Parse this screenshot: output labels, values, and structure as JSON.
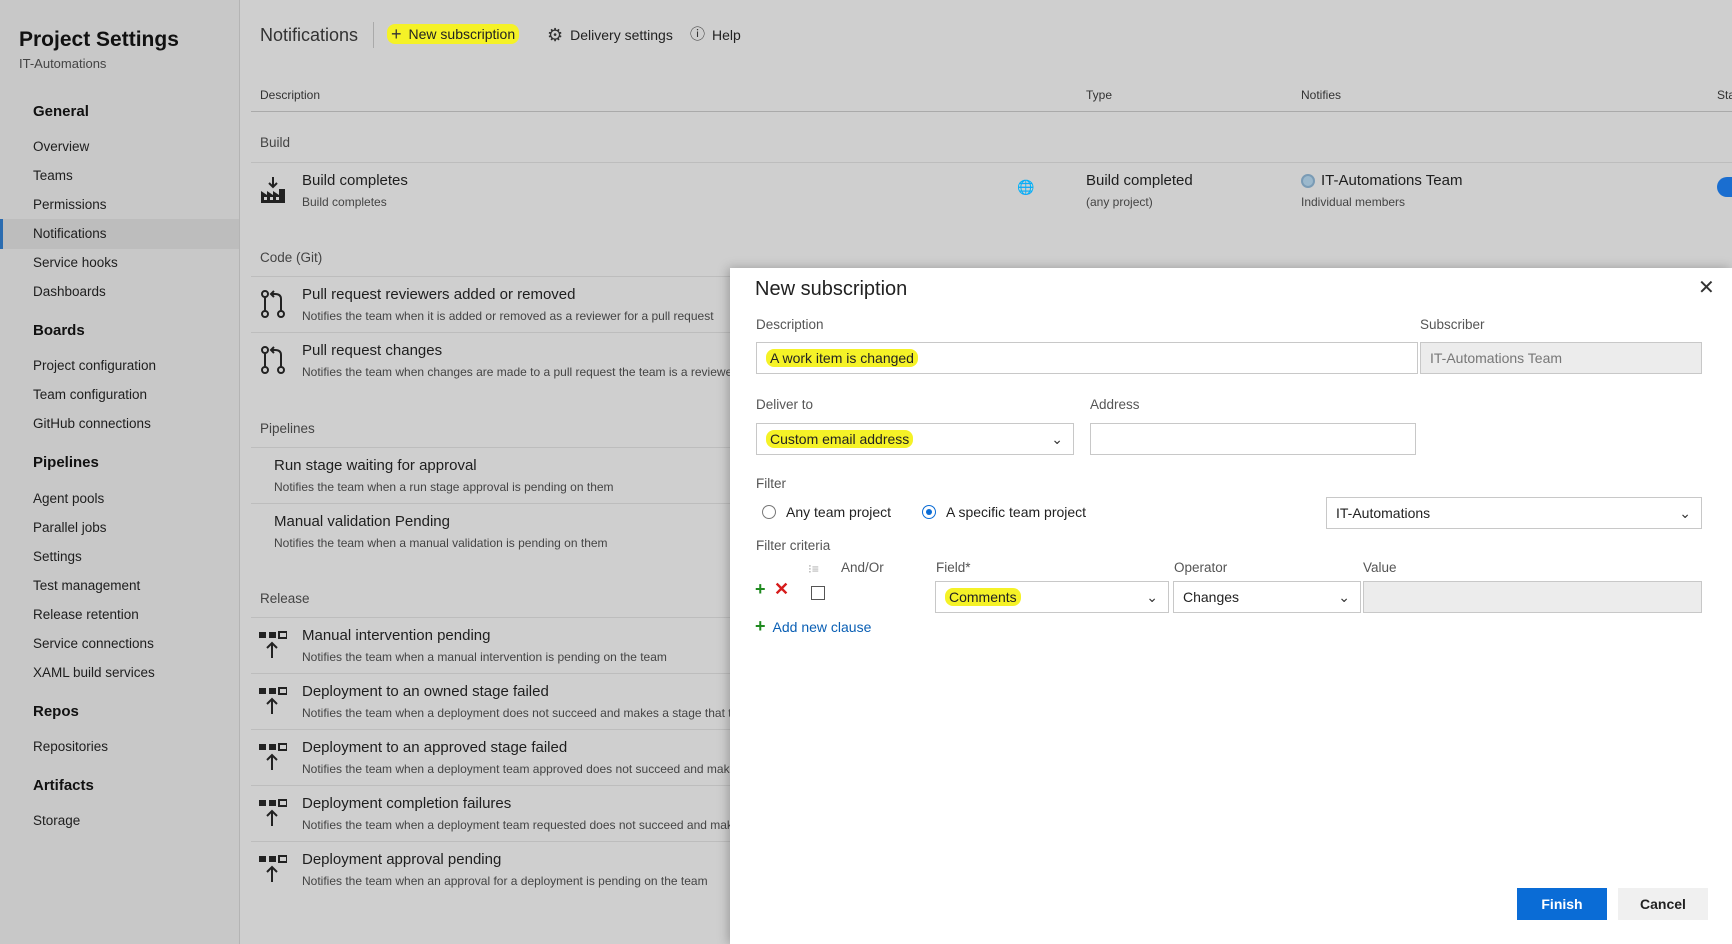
{
  "sidebar": {
    "title": "Project Settings",
    "subtitle": "IT-Automations",
    "sections": [
      {
        "label": "General",
        "items": [
          "Overview",
          "Teams",
          "Permissions",
          "Notifications",
          "Service hooks",
          "Dashboards"
        ]
      },
      {
        "label": "Boards",
        "items": [
          "Project configuration",
          "Team configuration",
          "GitHub connections"
        ]
      },
      {
        "label": "Pipelines",
        "items": [
          "Agent pools",
          "Parallel jobs",
          "Settings",
          "Test management",
          "Release retention",
          "Service connections",
          "XAML build services"
        ]
      },
      {
        "label": "Repos",
        "items": [
          "Repositories"
        ]
      },
      {
        "label": "Artifacts",
        "items": [
          "Storage"
        ]
      }
    ],
    "selected_item": "Notifications"
  },
  "toolbar": {
    "title": "Notifications",
    "new_subscription": "New subscription",
    "delivery_settings": "Delivery settings",
    "help": "Help"
  },
  "table": {
    "headers": {
      "description": "Description",
      "type": "Type",
      "notifies": "Notifies",
      "state": "State"
    },
    "groups": {
      "build": "Build",
      "code": "Code (Git)",
      "pipelines": "Pipelines",
      "release": "Release"
    },
    "build_row": {
      "title": "Build completes",
      "sub": "Build completes",
      "type": "Build completed",
      "type_sub": "(any project)",
      "notifies": "IT-Automations Team",
      "notifies_sub": "Individual members"
    },
    "code_rows": [
      {
        "title": "Pull request reviewers added or removed",
        "sub": "Notifies the team when it is added or removed as a reviewer for a pull request"
      },
      {
        "title": "Pull request changes",
        "sub": "Notifies the team when changes are made to a pull request the team is a reviewer"
      }
    ],
    "pipeline_rows": [
      {
        "title": "Run stage waiting for approval",
        "sub": "Notifies the team when a run stage approval is pending on them"
      },
      {
        "title": "Manual validation Pending",
        "sub": "Notifies the team when a manual validation is pending on them"
      }
    ],
    "release_rows": [
      {
        "title": "Manual intervention pending",
        "sub": "Notifies the team when a manual intervention is pending on the team"
      },
      {
        "title": "Deployment to an owned stage failed",
        "sub": "Notifies the team when a deployment does not succeed and makes a stage that th"
      },
      {
        "title": "Deployment to an approved stage failed",
        "sub": "Notifies the team when a deployment team approved does not succeed and make"
      },
      {
        "title": "Deployment completion failures",
        "sub": "Notifies the team when a deployment team requested does not succeed and mak"
      },
      {
        "title": "Deployment approval pending",
        "sub": "Notifies the team when an approval for a deployment is pending on the team"
      }
    ]
  },
  "dialog": {
    "title": "New subscription",
    "description_label": "Description",
    "description_value": "A work item is changed",
    "subscriber_label": "Subscriber",
    "subscriber_value": "IT-Automations Team",
    "deliver_to_label": "Deliver to",
    "deliver_to_value": "Custom email address",
    "address_label": "Address",
    "address_value": "",
    "filter_label": "Filter",
    "filter_any": "Any team project",
    "filter_specific": "A specific team project",
    "filter_project_value": "IT-Automations",
    "criteria_label": "Filter criteria",
    "andor_label": "And/Or",
    "field_label": "Field*",
    "field_value": "Comments",
    "operator_label": "Operator",
    "operator_value": "Changes",
    "value_label": "Value",
    "add_clause": "Add new clause",
    "finish": "Finish",
    "cancel": "Cancel"
  },
  "colors": {
    "accent": "#0a6cd6",
    "highlight": "#f5f227",
    "add_green": "#1f8a1f",
    "delete_red": "#d61b1b"
  }
}
